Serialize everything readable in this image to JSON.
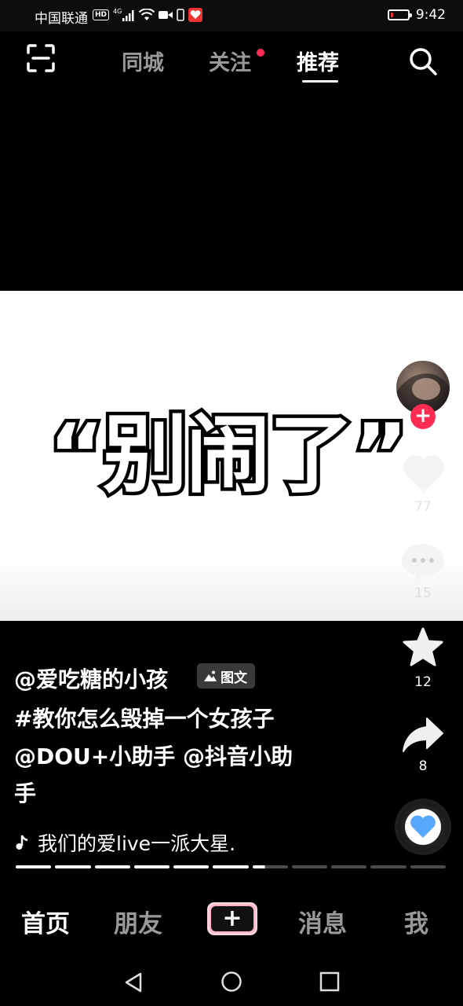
{
  "status_bar": {
    "carrier": "中国联通",
    "hd": "HD",
    "network": "4G",
    "time": "9:42",
    "battery_level": 0.15,
    "battery_color": "#e5343b"
  },
  "top_nav": {
    "tabs": [
      {
        "label": "同城"
      },
      {
        "label": "关注",
        "has_dot": true
      },
      {
        "label": "推荐",
        "active": true
      }
    ],
    "icons": [
      "scan-icon",
      "search-icon"
    ],
    "dot_color": "#fe2c55"
  },
  "post": {
    "image_text": "“别闹了”",
    "author": "@爱吃糖的小孩",
    "type_badge": "图文",
    "description": [
      "#教你怎么毁掉一个女孩子",
      "@DOU+小助手 @抖音小助",
      "手"
    ],
    "music": "我们的爱live一派大星.",
    "likes": "77",
    "comments": "15",
    "favorites": "12",
    "shares": "8",
    "progress": {
      "total_segments": 11,
      "completed": 6,
      "current_fraction": 0.35
    }
  },
  "bottom_nav": {
    "items": [
      {
        "label": "首页",
        "active": true
      },
      {
        "label": "朋友"
      },
      {
        "label": "+"
      },
      {
        "label": "消息"
      },
      {
        "label": "我"
      }
    ]
  },
  "system_nav": [
    "back-icon",
    "home-icon",
    "recents-icon"
  ],
  "colors": {
    "accent": "#fe2c55",
    "cyan": "#25f4ee",
    "heart": "#58a8ff"
  }
}
